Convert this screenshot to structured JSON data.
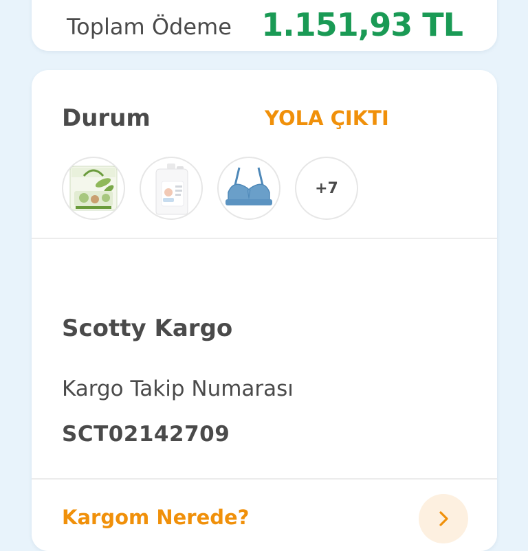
{
  "summary": {
    "total_label": "Toplam Ödeme",
    "total_value": "1.151,93 TL"
  },
  "order": {
    "status_label": "Durum",
    "status_value": "YOLA ÇIKTI",
    "status_color": "#f0900a",
    "products": [
      {
        "name": "product-thumbnail-wipes",
        "icon": "wipes-package-image"
      },
      {
        "name": "product-thumbnail-detergent",
        "icon": "detergent-bottle-image"
      },
      {
        "name": "product-thumbnail-bra",
        "icon": "blue-bra-image"
      }
    ],
    "more_count": "+7"
  },
  "shipping": {
    "carrier_name": "Scotty Kargo",
    "tracking_label": "Kargo Takip Numarası",
    "tracking_number": "SCT02142709",
    "where_link": "Kargom Nerede?"
  },
  "colors": {
    "accent_green": "#1a9a55",
    "accent_orange": "#f0900a",
    "background": "#e8f3fb"
  }
}
